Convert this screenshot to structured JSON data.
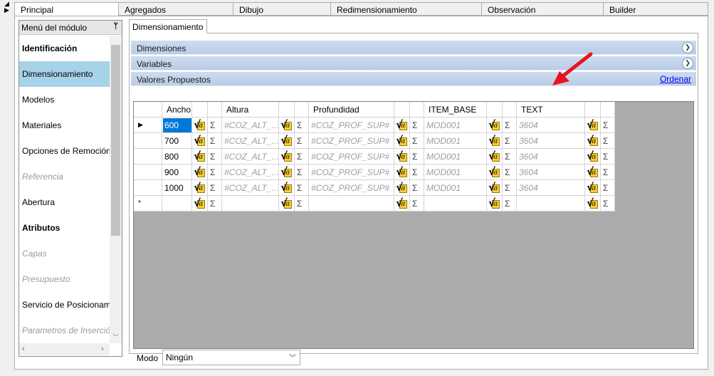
{
  "tabs": [
    "Principal",
    "Agregados",
    "Dibujo",
    "Redimensionamiento",
    "Observación",
    "Builder"
  ],
  "sidebar": {
    "title": "Menú del módulo",
    "pin_icon": "pin-icon",
    "items": [
      {
        "label": "Identificación",
        "style": "bold"
      },
      {
        "label": "Dimensionamiento",
        "style": "selected"
      },
      {
        "label": "Modelos",
        "style": "normal"
      },
      {
        "label": "Materiales",
        "style": "normal"
      },
      {
        "label": "Opciones de Remoción",
        "style": "normal"
      },
      {
        "label": "Referencia",
        "style": "disabled"
      },
      {
        "label": "Abertura",
        "style": "normal"
      },
      {
        "label": "Atributos",
        "style": "bold"
      },
      {
        "label": "Capas",
        "style": "disabled"
      },
      {
        "label": "Presupuesto",
        "style": "disabled"
      },
      {
        "label": "Servicio de Posicionamie",
        "style": "normal"
      },
      {
        "label": "Parametros de Inserción",
        "style": "disabled"
      }
    ]
  },
  "subtab": "Dimensionamiento",
  "sections": {
    "dimensiones": "Dimensiones",
    "variables": "Variables",
    "valores": "Valores Propuestos",
    "ordenar": "Ordenar"
  },
  "grid": {
    "columns": [
      "Ancho",
      "Altura",
      "Profundidad",
      "ITEM_BASE",
      "TEXT"
    ],
    "sigma": "Σ",
    "rows": [
      {
        "ancho": "600",
        "altura": "#COZ_ALT_...",
        "prof": "#COZ_PROF_SUP#",
        "item": "MOD001",
        "text": "3604",
        "current": true
      },
      {
        "ancho": "700",
        "altura": "#COZ_ALT_...",
        "prof": "#COZ_PROF_SUP#",
        "item": "MOD001",
        "text": "3604",
        "current": false
      },
      {
        "ancho": "800",
        "altura": "#COZ_ALT_...",
        "prof": "#COZ_PROF_SUP#",
        "item": "MOD001",
        "text": "3604",
        "current": false
      },
      {
        "ancho": "900",
        "altura": "#COZ_ALT_...",
        "prof": "#COZ_PROF_SUP#",
        "item": "MOD001",
        "text": "3604",
        "current": false
      },
      {
        "ancho": "1000",
        "altura": "#COZ_ALT_...",
        "prof": "#COZ_PROF_SUP#",
        "item": "MOD001",
        "text": "3604",
        "current": false
      }
    ],
    "new_row_marker": "*"
  },
  "modo": {
    "label": "Modo",
    "value": "Ningún"
  },
  "colors": {
    "selection": "#0078d7",
    "section_header": "#c3d5ec",
    "annotation_arrow": "#e8141c",
    "sidebar_selected": "#a7d3e9"
  }
}
